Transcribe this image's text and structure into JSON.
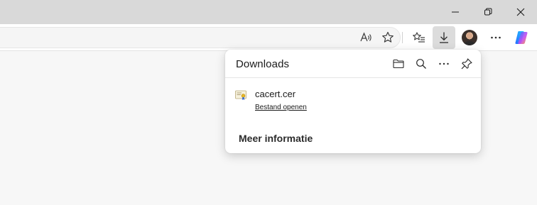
{
  "window": {
    "controls": [
      "minimize",
      "restore",
      "close"
    ]
  },
  "toolbar": {
    "icons": [
      "read-aloud-icon",
      "favorite-star-icon",
      "favorites-icon",
      "download-icon",
      "profile-avatar",
      "more-icon",
      "copilot-icon"
    ]
  },
  "downloads": {
    "title": "Downloads",
    "items": [
      {
        "file_name": "cacert.cer",
        "action_label": "Bestand openen",
        "icon": "certificate-file-icon"
      }
    ],
    "more_info_label": "Meer informatie",
    "header_icons": [
      "folder-icon",
      "search-icon",
      "more-icon",
      "pin-icon"
    ]
  },
  "colors": {
    "titlebar": "#d9d9d9",
    "toolbar": "#ffffff",
    "page": "#f7f7f7",
    "active_button": "#dcdcdc",
    "copilot_gradient": [
      "#2b7fff",
      "#c44df2",
      "#ff9a2b"
    ]
  }
}
